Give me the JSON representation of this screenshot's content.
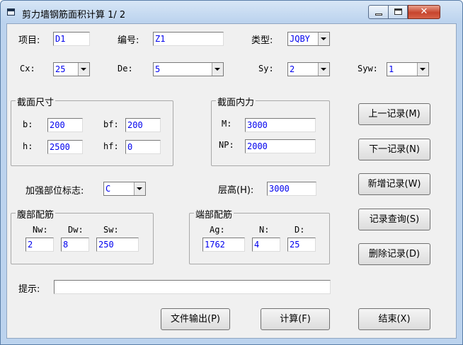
{
  "window": {
    "title": "剪力墙钢筋面积计算 1/ 2"
  },
  "top": {
    "project": {
      "label": "项目:",
      "value": "D1"
    },
    "number": {
      "label": "编号:",
      "value": "Z1"
    },
    "type": {
      "label": "类型:",
      "value": "JQBY"
    },
    "cx": {
      "label": "Cx:",
      "value": "25"
    },
    "de": {
      "label": "De:",
      "value": "5"
    },
    "sy": {
      "label": "Sy:",
      "value": "2"
    },
    "syw": {
      "label": "Syw:",
      "value": "1"
    }
  },
  "section_size": {
    "title": "截面尺寸",
    "b": {
      "label": "b:",
      "value": "200"
    },
    "bf": {
      "label": "bf:",
      "value": "200"
    },
    "h": {
      "label": "h:",
      "value": "2500"
    },
    "hf": {
      "label": "hf:",
      "value": "0"
    }
  },
  "section_force": {
    "title": "截面内力",
    "m": {
      "label": "M:",
      "value": "3000"
    },
    "np": {
      "label": "NP:",
      "value": "2000"
    }
  },
  "reinforce": {
    "label": "加强部位标志:",
    "value": "C"
  },
  "floor_height": {
    "label": "层高(H):",
    "value": "3000"
  },
  "web_rebar": {
    "title": "腹部配筋",
    "nw": {
      "label": "Nw:",
      "value": "2"
    },
    "dw": {
      "label": "Dw:",
      "value": "8"
    },
    "sw": {
      "label": "Sw:",
      "value": "250"
    }
  },
  "end_rebar": {
    "title": "端部配筋",
    "ag": {
      "label": "Ag:",
      "value": "1762"
    },
    "n": {
      "label": "N:",
      "value": "4"
    },
    "d": {
      "label": "D:",
      "value": "25"
    }
  },
  "hint": {
    "label": "提示:",
    "value": ""
  },
  "buttons": {
    "prev": "上一记录(M)",
    "next": "下一记录(N)",
    "add": "新增记录(W)",
    "query": "记录查询(S)",
    "delete": "删除记录(D)",
    "export": "文件输出(P)",
    "calc": "计算(F)",
    "end": "结束(X)"
  },
  "colors": {
    "value_text": "#0000ee",
    "face": "#f0f0f0",
    "frame": "#bcd3ee"
  }
}
